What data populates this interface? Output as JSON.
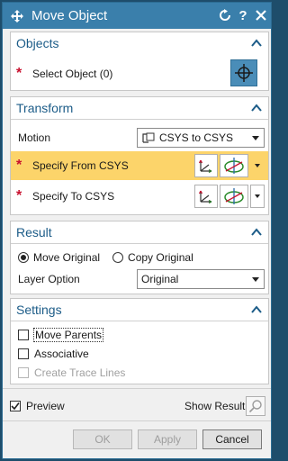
{
  "window": {
    "title": "Move Object",
    "reset_icon": "reset-icon",
    "help_icon": "help-icon",
    "close_icon": "close-icon",
    "help_label": "?"
  },
  "objects": {
    "header": "Objects",
    "select_object_label": "Select Object (0)"
  },
  "transform": {
    "header": "Transform",
    "motion_label": "Motion",
    "motion_value": "CSYS to CSYS",
    "from_csys_label": "Specify From CSYS",
    "to_csys_label": "Specify To CSYS"
  },
  "result": {
    "header": "Result",
    "move_original_label": "Move Original",
    "copy_original_label": "Copy Original",
    "selected": "Move Original",
    "layer_option_label": "Layer Option",
    "layer_option_value": "Original"
  },
  "settings": {
    "header": "Settings",
    "move_parents_label": "Move Parents",
    "associative_label": "Associative",
    "create_trace_lines_label": "Create Trace Lines"
  },
  "footer": {
    "preview_label": "Preview",
    "preview_checked": true,
    "show_result_label": "Show Result",
    "ok_label": "OK",
    "apply_label": "Apply",
    "cancel_label": "Cancel"
  },
  "colors": {
    "titlebar": "#3a7fab",
    "section_header_text": "#1c5c88",
    "highlight_row": "#fcd46a",
    "required_star": "#c8102e"
  }
}
